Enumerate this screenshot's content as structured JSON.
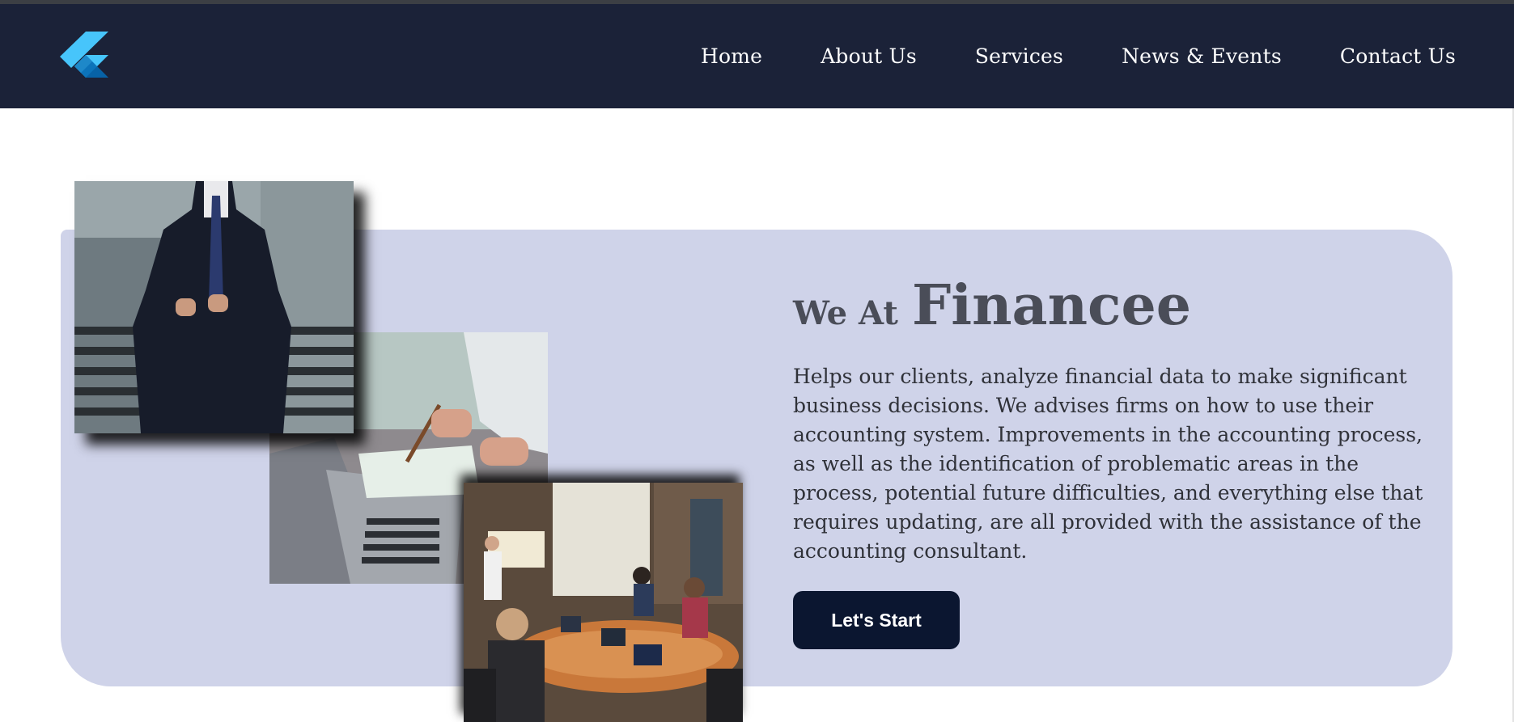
{
  "header": {
    "logo_icon": "flutter-logo-icon",
    "nav": [
      "Home",
      "About Us",
      "Services",
      "News & Events",
      "Contact Us"
    ]
  },
  "hero": {
    "title_prefix": "We At",
    "title_brand": "Financee",
    "description": "Helps our clients, analyze financial data to make significant business decisions. We advises firms on how to use their accounting system. Improvements in the accounting process, as well as the identification of problematic areas in the process, potential future difficulties, and everything else that requires updating, are all provided with the assistance of the accounting consultant.",
    "cta_label": "Let's Start",
    "images": [
      "businessman-suit-photo",
      "laptop-notes-photo",
      "meeting-room-photo"
    ]
  },
  "colors": {
    "navbar": "#1b2238",
    "panel": "#cfd3e9",
    "button": "#0b1630",
    "title": "#4a4d58"
  }
}
